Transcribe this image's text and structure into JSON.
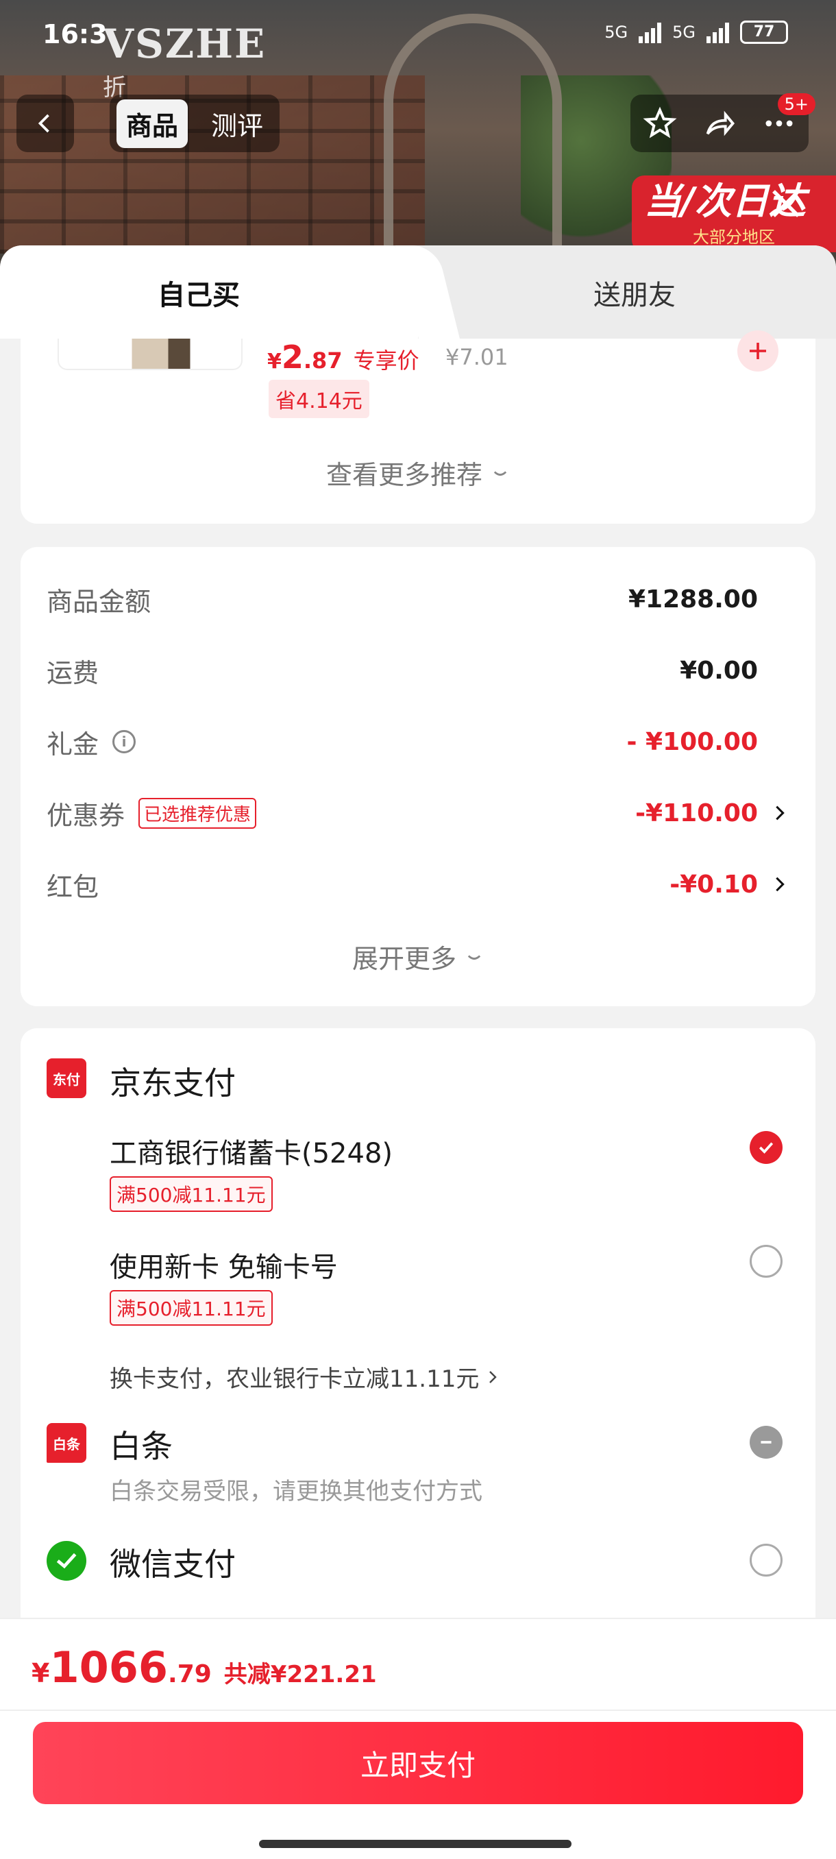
{
  "status_bar": {
    "time": "16:3",
    "network1": "5G",
    "network2": "5G",
    "battery": "77"
  },
  "background": {
    "brand": "VSZHE",
    "brand_sub": "折",
    "promo_title": "当/次日达",
    "promo_sub": "大部分地区",
    "nav_tabs": [
      "商品",
      "测评"
    ],
    "badge": "5+"
  },
  "sheet": {
    "tabs": {
      "self": "自己买",
      "friend": "送朋友"
    },
    "recommend": {
      "price_yen": "¥",
      "price_int": "2",
      "price_dec": ".87",
      "price_tag": "专享价",
      "original_price": "¥7.01",
      "save": "省4.14元",
      "more": "查看更多推荐"
    },
    "amount": {
      "rows": [
        {
          "label": "商品金额",
          "value": "¥1288.00"
        },
        {
          "label": "运费",
          "value": "¥0.00"
        },
        {
          "label": "礼金",
          "value": "- ¥100.00"
        },
        {
          "label": "优惠券",
          "tag": "已选推荐优惠",
          "value": "-¥110.00"
        },
        {
          "label": "红包",
          "value": "-¥0.10"
        }
      ],
      "expand": "展开更多"
    },
    "payment": {
      "jd_title": "京东支付",
      "jd_logo": "东付",
      "icbc": "工商银行储蓄卡(5248)",
      "icbc_tag": "满500减11.11元",
      "new_card": "使用新卡 免输卡号",
      "new_card_tag": "满500减11.11元",
      "swap": "换卡支付，农业银行卡立减11.11元",
      "baitiao_title": "白条",
      "baitiao_logo": "白条",
      "baitiao_desc": "白条交易受限，请更换其他支付方式",
      "wechat_title": "微信支付"
    }
  },
  "bottom": {
    "yen": "¥",
    "total_int": "1066",
    "total_dec": ".79",
    "saved": "共减¥221.21",
    "pay_button": "立即支付"
  },
  "colors": {
    "accent": "#e6202c",
    "wechat": "#1aad19"
  }
}
